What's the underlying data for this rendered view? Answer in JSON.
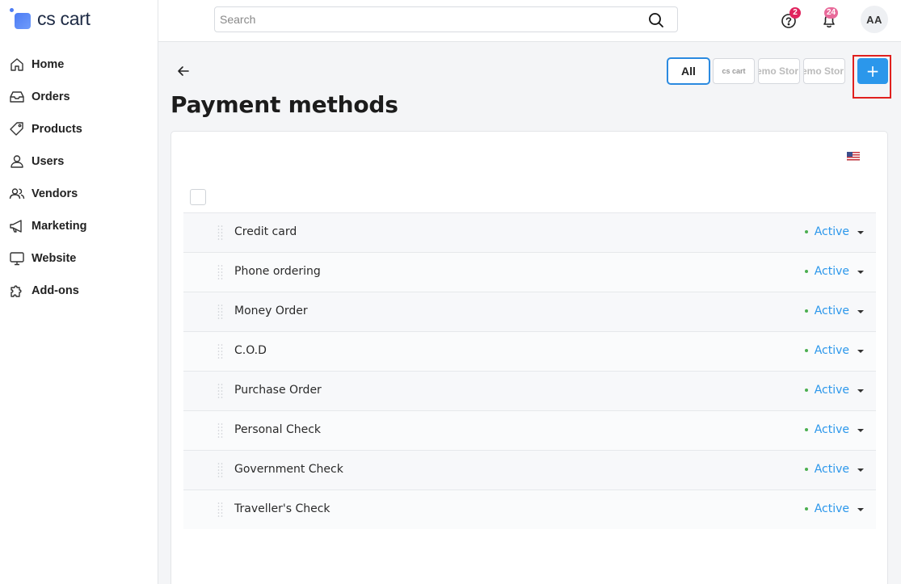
{
  "app": {
    "logo_text": "cs cart",
    "accent": "#2b97eb",
    "status_color": "#4caf50"
  },
  "sidebar": {
    "items": [
      {
        "label": "Home",
        "icon": "home-icon"
      },
      {
        "label": "Orders",
        "icon": "inbox-icon"
      },
      {
        "label": "Products",
        "icon": "tag-icon"
      },
      {
        "label": "Users",
        "icon": "user-icon"
      },
      {
        "label": "Vendors",
        "icon": "users-icon"
      },
      {
        "label": "Marketing",
        "icon": "megaphone-icon"
      },
      {
        "label": "Website",
        "icon": "monitor-icon"
      },
      {
        "label": "Add-ons",
        "icon": "puzzle-icon"
      }
    ]
  },
  "header": {
    "search_placeholder": "Search",
    "help_badge": "2",
    "notifications_badge": "24",
    "avatar_initials": "AA"
  },
  "page": {
    "title": "Payment methods",
    "store_filters": [
      {
        "label": "All"
      },
      {
        "label": "cs cart"
      },
      {
        "label": "emo Stor"
      },
      {
        "label": "emo Stor"
      }
    ],
    "add_label": "+"
  },
  "payments": [
    {
      "name": "Credit card",
      "status": "Active"
    },
    {
      "name": "Phone ordering",
      "status": "Active"
    },
    {
      "name": "Money Order",
      "status": "Active"
    },
    {
      "name": "C.O.D",
      "status": "Active"
    },
    {
      "name": "Purchase Order",
      "status": "Active"
    },
    {
      "name": "Personal Check",
      "status": "Active"
    },
    {
      "name": "Government Check",
      "status": "Active"
    },
    {
      "name": "Traveller's Check",
      "status": "Active"
    }
  ]
}
